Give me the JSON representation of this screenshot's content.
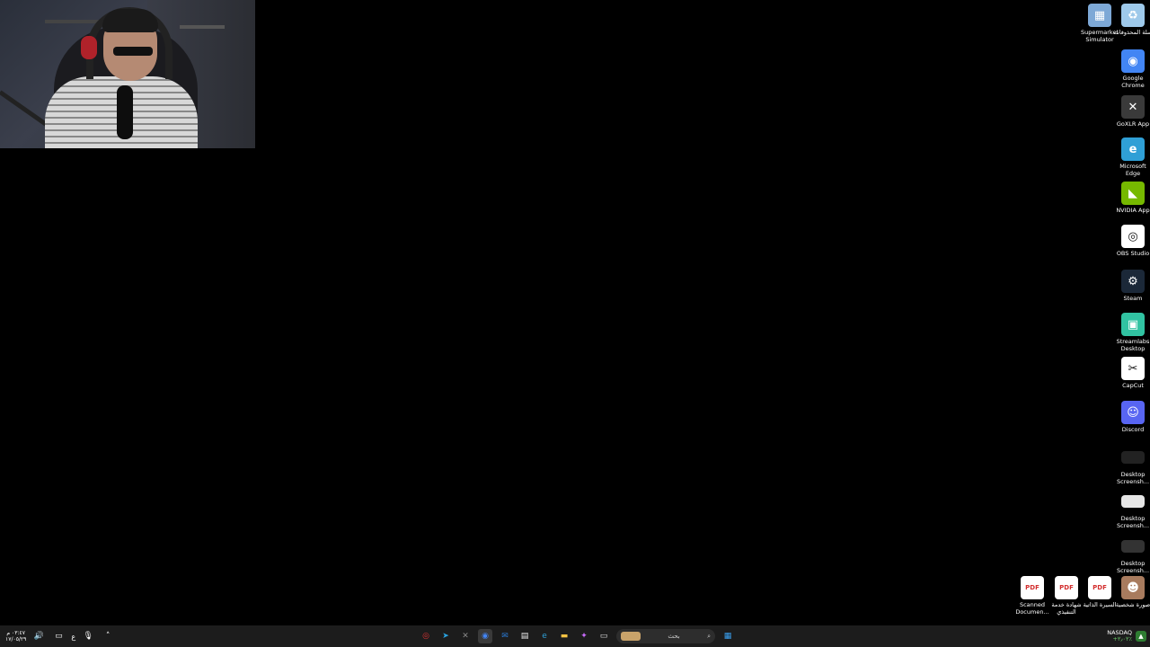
{
  "desktop_icons": [
    {
      "label": "سلة المحذوفات",
      "icon": "recycle-bin-icon",
      "color": "#9ec9ea"
    },
    {
      "label": "Supermarket Simulator",
      "icon": "supermarket-simulator-icon",
      "color": "#7da8d6"
    },
    {
      "label": "Google Chrome",
      "icon": "chrome-icon",
      "color": "#4285f4"
    },
    {
      "label": "GoXLR App",
      "icon": "goxlr-icon",
      "color": "#3a3a3a"
    },
    {
      "label": "Microsoft Edge",
      "icon": "edge-icon",
      "color": "#2f9fd6"
    },
    {
      "label": "NVIDIA App",
      "icon": "nvidia-icon",
      "color": "#76b900"
    },
    {
      "label": "OBS Studio",
      "icon": "obs-icon",
      "color": "#ffffff"
    },
    {
      "label": "Steam",
      "icon": "steam-icon",
      "color": "#1b2838"
    },
    {
      "label": "Streamlabs Desktop",
      "icon": "streamlabs-icon",
      "color": "#31c3a2"
    },
    {
      "label": "CapCut",
      "icon": "capcut-icon",
      "color": "#ffffff"
    },
    {
      "label": "Discord",
      "icon": "discord-icon",
      "color": "#5865f2"
    },
    {
      "label": "Desktop Screensh...",
      "icon": "screenshot-icon",
      "color": "#222222"
    },
    {
      "label": "Desktop Screensh...",
      "icon": "screenshot-icon",
      "color": "#e6e6e6"
    },
    {
      "label": "Desktop Screensh...",
      "icon": "screenshot-icon",
      "color": "#333333"
    },
    {
      "label": "صورة شخصية",
      "icon": "photo-icon",
      "color": "#a87b5e"
    },
    {
      "label": "السيرة الذاتية",
      "icon": "pdf-icon",
      "color": "#d32f2f"
    },
    {
      "label": "شهادة خدمة التنفيذي",
      "icon": "pdf-icon",
      "color": "#d32f2f"
    },
    {
      "label": "Scanned Documen...",
      "icon": "pdf-icon",
      "color": "#d32f2f"
    }
  ],
  "pdf_badge": "PDF",
  "taskbar": {
    "search_placeholder": "بحث",
    "apps": [
      {
        "icon": "windows-start-icon",
        "color": "#3aa0f0"
      },
      {
        "icon": "search-icon",
        "color": "#dddddd"
      },
      {
        "icon": "file-explorer-window-icon",
        "color": "#e0e0e0"
      },
      {
        "icon": "copilot-icon",
        "color": "#c86bfa"
      },
      {
        "icon": "folder-icon",
        "color": "#f6c343"
      },
      {
        "icon": "edge-icon",
        "color": "#2f9fd6"
      },
      {
        "icon": "store-icon",
        "color": "#eeeeee"
      },
      {
        "icon": "outlook-icon",
        "color": "#2a7bd6"
      },
      {
        "icon": "chrome-icon",
        "color": "#4285f4"
      },
      {
        "icon": "goxlr-icon",
        "color": "#888888"
      },
      {
        "icon": "telegram-icon",
        "color": "#2aa3e0"
      },
      {
        "icon": "obs-taskbar-icon",
        "color": "#d33"
      }
    ],
    "stock_name": "NASDAQ",
    "stock_change": "+٢٫٠٢٪",
    "language": "ع",
    "time": "٠٣:٤٧ م",
    "date": "١٧/٠٥/٢٩"
  }
}
